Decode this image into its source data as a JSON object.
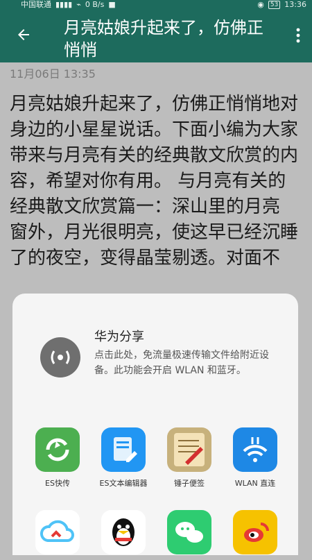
{
  "statusbar": {
    "carrier": "中国联通",
    "speed": "0 B/s",
    "battery": "53",
    "time": "13:36"
  },
  "appbar": {
    "title": "月亮姑娘升起来了，仿佛正悄悄",
    "back_icon": "arrow-left-icon",
    "more_icon": "more-vert-icon"
  },
  "article": {
    "date": "11月06日 13:35",
    "body": "月亮姑娘升起来了，仿佛正悄悄地对身边的小星星说话。下面小编为大家带来与月亮有关的经典散文欣赏的内容，希望对你有用。 与月亮有关的经典散文欣赏篇一：深山里的月亮 窗外，月光很明亮，使这早已经沉睡了的夜空，变得晶莹剔透。对面不"
  },
  "share_sheet": {
    "huawei_share": {
      "title": "华为分享",
      "desc": "点击此处，免流量极速传输文件给附近设备。此功能会开启 WLAN 和蓝牙。"
    },
    "apps": [
      {
        "label": "ES快传",
        "color": "#4caf50"
      },
      {
        "label": "ES文本编辑器",
        "color": "#2196f3"
      },
      {
        "label": "锤子便签",
        "color": "#c7b17c"
      },
      {
        "label": "WLAN 直连",
        "color": "#1e88e5"
      },
      {
        "label": "",
        "color": "#ffffff"
      },
      {
        "label": "",
        "color": "#ffffff"
      },
      {
        "label": "",
        "color": "#2ecc71"
      },
      {
        "label": "",
        "color": "#f6c200"
      }
    ]
  }
}
